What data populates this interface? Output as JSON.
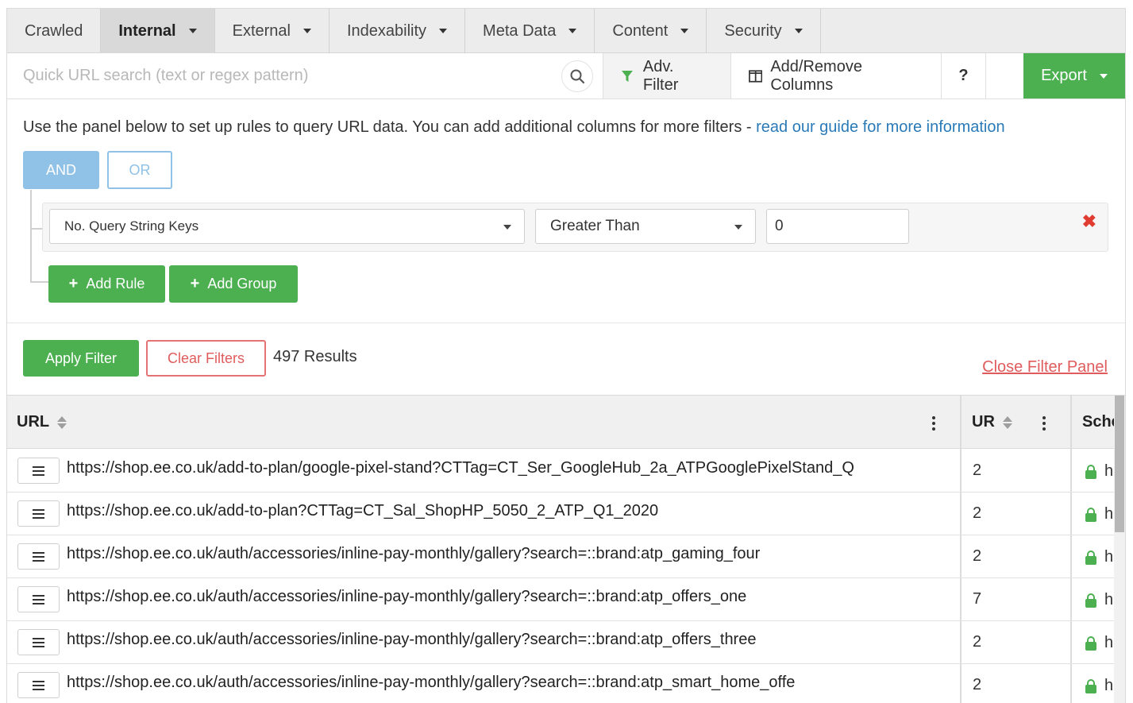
{
  "tabs": [
    {
      "label": "Crawled",
      "dropdown": false,
      "active": false
    },
    {
      "label": "Internal",
      "dropdown": true,
      "active": true
    },
    {
      "label": "External",
      "dropdown": true,
      "active": false
    },
    {
      "label": "Indexability",
      "dropdown": true,
      "active": false
    },
    {
      "label": "Meta Data",
      "dropdown": true,
      "active": false
    },
    {
      "label": "Content",
      "dropdown": true,
      "active": false
    },
    {
      "label": "Security",
      "dropdown": true,
      "active": false
    }
  ],
  "toolbar": {
    "search_placeholder": "Quick URL search (text or regex pattern)",
    "adv_filter_label": "Adv. Filter",
    "columns_label": "Add/Remove Columns",
    "help_label": "?",
    "export_label": "Export"
  },
  "filter_panel": {
    "intro_text": "Use the panel below to set up rules to query URL data. You can add additional columns for more filters - ",
    "guide_link": "read our guide for more information",
    "and_label": "AND",
    "or_label": "OR",
    "rule": {
      "field": "No. Query String Keys",
      "operator": "Greater Than",
      "value": "0",
      "remove_symbol": "✖"
    },
    "add_rule_label": "Add Rule",
    "add_group_label": "Add Group",
    "plus_symbol": "+",
    "apply_label": "Apply Filter",
    "clear_label": "Clear Filters",
    "results_text": "497 Results",
    "close_label": "Close Filter Panel"
  },
  "table": {
    "columns": [
      "URL",
      "UR",
      "Sche"
    ],
    "rows": [
      {
        "url": "https://shop.ee.co.uk/add-to-plan/google-pixel-stand?CTTag=CT_Ser_GoogleHub_2a_ATPGooglePixelStand_Q",
        "ur": "2",
        "scheme": "h"
      },
      {
        "url": "https://shop.ee.co.uk/add-to-plan?CTTag=CT_Sal_ShopHP_5050_2_ATP_Q1_2020",
        "ur": "2",
        "scheme": "h"
      },
      {
        "url": "https://shop.ee.co.uk/auth/accessories/inline-pay-monthly/gallery?search=::brand:atp_gaming_four",
        "ur": "2",
        "scheme": "h"
      },
      {
        "url": "https://shop.ee.co.uk/auth/accessories/inline-pay-monthly/gallery?search=::brand:atp_offers_one",
        "ur": "7",
        "scheme": "h"
      },
      {
        "url": "https://shop.ee.co.uk/auth/accessories/inline-pay-monthly/gallery?search=::brand:atp_offers_three",
        "ur": "2",
        "scheme": "h"
      },
      {
        "url": "https://shop.ee.co.uk/auth/accessories/inline-pay-monthly/gallery?search=::brand:atp_smart_home_offe",
        "ur": "2",
        "scheme": "h"
      }
    ]
  },
  "colors": {
    "green": "#4caf50",
    "blue_link": "#2a7ab8",
    "and_blue": "#90c2e7",
    "red": "#e05c5c"
  }
}
